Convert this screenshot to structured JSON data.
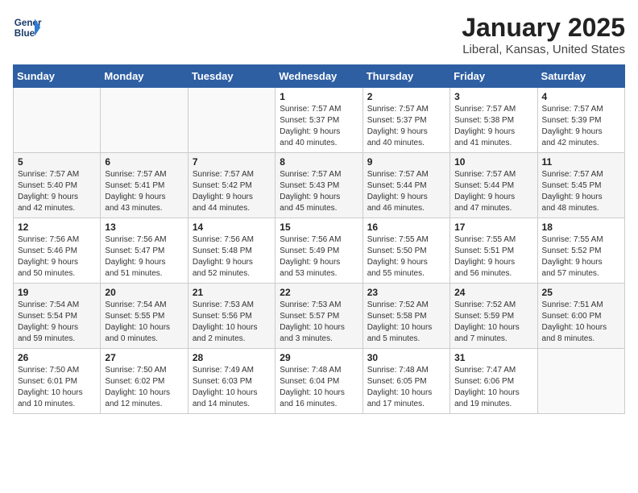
{
  "header": {
    "logo_line1": "General",
    "logo_line2": "Blue",
    "month_title": "January 2025",
    "location": "Liberal, Kansas, United States"
  },
  "days_of_week": [
    "Sunday",
    "Monday",
    "Tuesday",
    "Wednesday",
    "Thursday",
    "Friday",
    "Saturday"
  ],
  "weeks": [
    [
      {
        "day": "",
        "info": ""
      },
      {
        "day": "",
        "info": ""
      },
      {
        "day": "",
        "info": ""
      },
      {
        "day": "1",
        "info": "Sunrise: 7:57 AM\nSunset: 5:37 PM\nDaylight: 9 hours\nand 40 minutes."
      },
      {
        "day": "2",
        "info": "Sunrise: 7:57 AM\nSunset: 5:37 PM\nDaylight: 9 hours\nand 40 minutes."
      },
      {
        "day": "3",
        "info": "Sunrise: 7:57 AM\nSunset: 5:38 PM\nDaylight: 9 hours\nand 41 minutes."
      },
      {
        "day": "4",
        "info": "Sunrise: 7:57 AM\nSunset: 5:39 PM\nDaylight: 9 hours\nand 42 minutes."
      }
    ],
    [
      {
        "day": "5",
        "info": "Sunrise: 7:57 AM\nSunset: 5:40 PM\nDaylight: 9 hours\nand 42 minutes."
      },
      {
        "day": "6",
        "info": "Sunrise: 7:57 AM\nSunset: 5:41 PM\nDaylight: 9 hours\nand 43 minutes."
      },
      {
        "day": "7",
        "info": "Sunrise: 7:57 AM\nSunset: 5:42 PM\nDaylight: 9 hours\nand 44 minutes."
      },
      {
        "day": "8",
        "info": "Sunrise: 7:57 AM\nSunset: 5:43 PM\nDaylight: 9 hours\nand 45 minutes."
      },
      {
        "day": "9",
        "info": "Sunrise: 7:57 AM\nSunset: 5:44 PM\nDaylight: 9 hours\nand 46 minutes."
      },
      {
        "day": "10",
        "info": "Sunrise: 7:57 AM\nSunset: 5:44 PM\nDaylight: 9 hours\nand 47 minutes."
      },
      {
        "day": "11",
        "info": "Sunrise: 7:57 AM\nSunset: 5:45 PM\nDaylight: 9 hours\nand 48 minutes."
      }
    ],
    [
      {
        "day": "12",
        "info": "Sunrise: 7:56 AM\nSunset: 5:46 PM\nDaylight: 9 hours\nand 50 minutes."
      },
      {
        "day": "13",
        "info": "Sunrise: 7:56 AM\nSunset: 5:47 PM\nDaylight: 9 hours\nand 51 minutes."
      },
      {
        "day": "14",
        "info": "Sunrise: 7:56 AM\nSunset: 5:48 PM\nDaylight: 9 hours\nand 52 minutes."
      },
      {
        "day": "15",
        "info": "Sunrise: 7:56 AM\nSunset: 5:49 PM\nDaylight: 9 hours\nand 53 minutes."
      },
      {
        "day": "16",
        "info": "Sunrise: 7:55 AM\nSunset: 5:50 PM\nDaylight: 9 hours\nand 55 minutes."
      },
      {
        "day": "17",
        "info": "Sunrise: 7:55 AM\nSunset: 5:51 PM\nDaylight: 9 hours\nand 56 minutes."
      },
      {
        "day": "18",
        "info": "Sunrise: 7:55 AM\nSunset: 5:52 PM\nDaylight: 9 hours\nand 57 minutes."
      }
    ],
    [
      {
        "day": "19",
        "info": "Sunrise: 7:54 AM\nSunset: 5:54 PM\nDaylight: 9 hours\nand 59 minutes."
      },
      {
        "day": "20",
        "info": "Sunrise: 7:54 AM\nSunset: 5:55 PM\nDaylight: 10 hours\nand 0 minutes."
      },
      {
        "day": "21",
        "info": "Sunrise: 7:53 AM\nSunset: 5:56 PM\nDaylight: 10 hours\nand 2 minutes."
      },
      {
        "day": "22",
        "info": "Sunrise: 7:53 AM\nSunset: 5:57 PM\nDaylight: 10 hours\nand 3 minutes."
      },
      {
        "day": "23",
        "info": "Sunrise: 7:52 AM\nSunset: 5:58 PM\nDaylight: 10 hours\nand 5 minutes."
      },
      {
        "day": "24",
        "info": "Sunrise: 7:52 AM\nSunset: 5:59 PM\nDaylight: 10 hours\nand 7 minutes."
      },
      {
        "day": "25",
        "info": "Sunrise: 7:51 AM\nSunset: 6:00 PM\nDaylight: 10 hours\nand 8 minutes."
      }
    ],
    [
      {
        "day": "26",
        "info": "Sunrise: 7:50 AM\nSunset: 6:01 PM\nDaylight: 10 hours\nand 10 minutes."
      },
      {
        "day": "27",
        "info": "Sunrise: 7:50 AM\nSunset: 6:02 PM\nDaylight: 10 hours\nand 12 minutes."
      },
      {
        "day": "28",
        "info": "Sunrise: 7:49 AM\nSunset: 6:03 PM\nDaylight: 10 hours\nand 14 minutes."
      },
      {
        "day": "29",
        "info": "Sunrise: 7:48 AM\nSunset: 6:04 PM\nDaylight: 10 hours\nand 16 minutes."
      },
      {
        "day": "30",
        "info": "Sunrise: 7:48 AM\nSunset: 6:05 PM\nDaylight: 10 hours\nand 17 minutes."
      },
      {
        "day": "31",
        "info": "Sunrise: 7:47 AM\nSunset: 6:06 PM\nDaylight: 10 hours\nand 19 minutes."
      },
      {
        "day": "",
        "info": ""
      }
    ]
  ]
}
